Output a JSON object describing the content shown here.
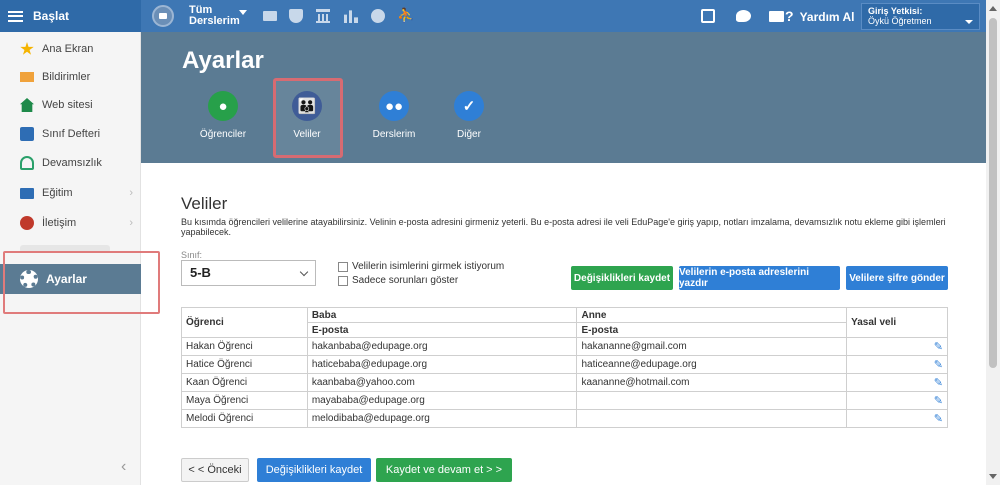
{
  "topbar": {
    "start_label": "Başlat",
    "course_line1": "Tüm",
    "course_line2": "Derslerim",
    "help_label": "Yardım Al",
    "user_label": "Giriş Yetkisi:",
    "user_name": "Öykü Öğretmen"
  },
  "sidebar": {
    "items": [
      {
        "label": "Ana Ekran",
        "icon": "star-icon"
      },
      {
        "label": "Bildirimler",
        "icon": "envelope-icon"
      },
      {
        "label": "Web sitesi",
        "icon": "home-icon"
      },
      {
        "label": "Sınıf Defteri",
        "icon": "book-icon"
      },
      {
        "label": "Devamsızlık",
        "icon": "user-icon"
      },
      {
        "label": "Eğitim",
        "icon": "education-icon"
      },
      {
        "label": "İletişim",
        "icon": "chat-icon"
      },
      {
        "label": "Ayarlar",
        "icon": "gear-icon"
      }
    ]
  },
  "header": {
    "title": "Ayarlar",
    "tabs": [
      {
        "label": "Öğrenciler",
        "icon": "student-icon"
      },
      {
        "label": "Veliler",
        "icon": "parents-icon"
      },
      {
        "label": "Derslerim",
        "icon": "group-icon"
      },
      {
        "label": "Diğer",
        "icon": "check-icon"
      }
    ]
  },
  "section": {
    "title": "Veliler",
    "description": "Bu kısımda öğrencileri velilerine atayabilirsiniz. Velinin e-posta adresini girmeniz yeterli. Bu e-posta adresi ile veli EduPage'e giriş yapıp, notları imzalama, devamsızlık notu ekleme gibi işlemleri yapabilecek.",
    "class_label": "Sınıf:",
    "class_value": "5-B",
    "checkbox1": "Velilerin isimlerini girmek istiyorum",
    "checkbox2": "Sadece sorunları göster",
    "btn_save": "Değişiklikleri kaydet",
    "btn_print": "Velilerin e-posta adreslerini yazdır",
    "btn_password": "Velilere şifre gönder"
  },
  "table": {
    "col_student": "Öğrenci",
    "col_father": "Baba",
    "col_mother": "Anne",
    "col_guardian": "Yasal veli",
    "sub_email": "E-posta",
    "rows": [
      {
        "student": "Hakan Öğrenci",
        "father": "hakanbaba@edupage.org",
        "mother": "hakananne@gmail.com"
      },
      {
        "student": "Hatice Öğrenci",
        "father": "haticebaba@edupage.org",
        "mother": "haticeanne@edupage.org"
      },
      {
        "student": "Kaan Öğrenci",
        "father": "kaanbaba@yahoo.com",
        "mother": "kaananne@hotmail.com"
      },
      {
        "student": "Maya Öğrenci",
        "father": "mayababa@edupage.org",
        "mother": ""
      },
      {
        "student": "Melodi Öğrenci",
        "father": "melodibaba@edupage.org",
        "mother": ""
      }
    ]
  },
  "footer": {
    "prev": "< < Önceki",
    "save": "Değişiklikleri kaydet",
    "next": "Kaydet ve devam et > >"
  },
  "colors": {
    "topbar": "#3e77b4",
    "header": "#5b7b93",
    "green": "#2ea44f",
    "blue": "#2f7fd6",
    "highlight": "#d76b72"
  }
}
